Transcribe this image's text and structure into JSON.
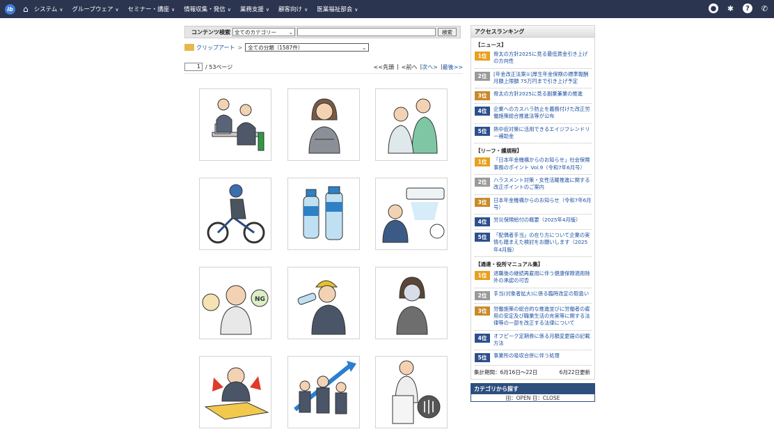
{
  "nav": {
    "logo_text": "ib",
    "items": [
      "システム",
      "グループウェア",
      "セミナー・講座",
      "情報収集・発信",
      "業務支援",
      "顧客向け",
      "医業福祉部会"
    ]
  },
  "search": {
    "label": "コンテンツ検索",
    "category_value": "全てのカテゴリー",
    "query_value": "",
    "button": "検索"
  },
  "breadcrumb": {
    "link": "クリップアート",
    "sep": ">",
    "select_value": "全ての分類（1587件）"
  },
  "pager": {
    "current": "1",
    "total": "/ 53ページ",
    "first": "<<先頭",
    "prev": "<前へ",
    "next": "次へ>",
    "last": "最後>>"
  },
  "clipart": [
    "office-meeting",
    "businesswoman",
    "nurse-care",
    "cyclist",
    "water-bottles",
    "air-conditioner-worker",
    "worker-ng",
    "worker-drinking",
    "sick-woman",
    "cooking-fire",
    "team-growth",
    "doctor-xray"
  ],
  "ranking": {
    "title": "アクセスランキング",
    "groups": [
      {
        "name": "【ニュース】",
        "items": [
          {
            "rank": "1位",
            "title": "骨太の方針2025に見る最低賃金引き上げの方向性"
          },
          {
            "rank": "2位",
            "title": "[年金改正法案①]厚生年金保険の標準報酬月額上限額 75万円まで引き上げ予定"
          },
          {
            "rank": "3位",
            "title": "骨太の方針2025に見る副業兼業の推進"
          },
          {
            "rank": "4位",
            "title": "企業へのカスハラ防止を義務付けた改正労働施策総合推進法等が公布"
          },
          {
            "rank": "5位",
            "title": "熱中症対策に活用できるエイジフレンドリー補助金"
          }
        ]
      },
      {
        "name": "【リーフ・護規程】",
        "items": [
          {
            "rank": "1位",
            "title": "「日本年金機構からのお知らせ」社会保険事務のポイント Vol.9（令和7年6月号）"
          },
          {
            "rank": "2位",
            "title": "ハラスメント対策・女性活躍推進に関する改正ポイントのご案内"
          },
          {
            "rank": "3位",
            "title": "日本年金機構からのお知らせ（令和7年6月号）"
          },
          {
            "rank": "4位",
            "title": "労災保険給付の概要（2025年4月版）"
          },
          {
            "rank": "5位",
            "title": "「配偶者手当」の在り方について企業の実情も踏まえた検討をお願いします（2025年4月版）"
          }
        ]
      },
      {
        "name": "【通達・役所マニュアル集】",
        "items": [
          {
            "rank": "1位",
            "title": "退職後の継続再雇用に伴う健康保険適用除外の承認の可否"
          },
          {
            "rank": "2位",
            "title": "手当(対象者拡大)に係る臨時改定の取扱い"
          },
          {
            "rank": "3位",
            "title": "労働施策の総合的な推進並びに労働者の雇用の安定及び職業生活の充実等に関する法律等の一部を改正する法律について"
          },
          {
            "rank": "4位",
            "title": "オフピーク定期券に係る月額変更届の記載方法"
          },
          {
            "rank": "5位",
            "title": "事業所の吸収合併に伴う処理"
          }
        ]
      }
    ],
    "period": "集計期間：6月16日～22日",
    "updated": "6月22日更新"
  },
  "category": {
    "title": "カテゴリから探す",
    "open_close": "田：OPEN 日：CLOSE"
  },
  "colors": {
    "rank1": "#e8a01e",
    "rank2": "#9a9a9a",
    "rank3": "#c98a2a",
    "rank4": "#2d4f8e",
    "rank5": "#2d4f8e",
    "nav": "#2b3550"
  }
}
